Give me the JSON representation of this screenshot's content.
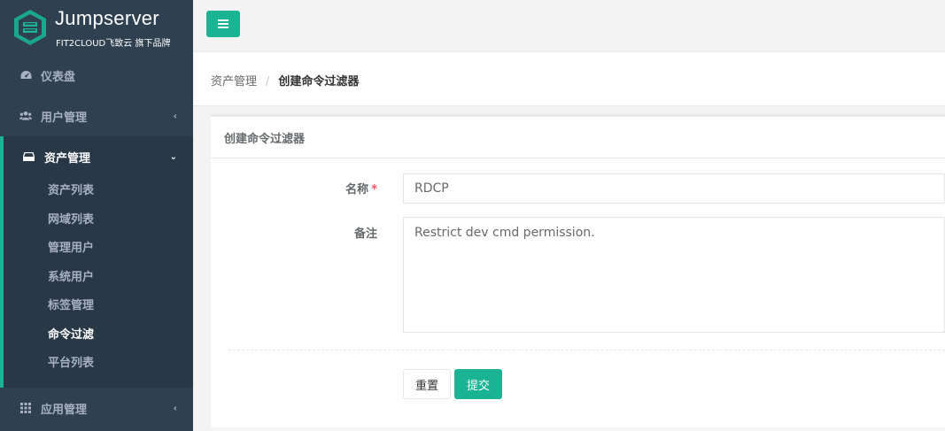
{
  "brand": {
    "title": "Jumpserver",
    "subtitle": "FIT2CLOUD飞致云 旗下品牌"
  },
  "sidebar": {
    "items": [
      {
        "label": "仪表盘",
        "icon": "dashboard-icon"
      },
      {
        "label": "用户管理",
        "icon": "users-icon"
      },
      {
        "label": "资产管理",
        "icon": "inbox-icon",
        "children": [
          "资产列表",
          "网域列表",
          "管理用户",
          "系统用户",
          "标签管理",
          "命令过滤",
          "平台列表"
        ]
      },
      {
        "label": "应用管理",
        "icon": "grid-icon"
      }
    ]
  },
  "breadcrumb": {
    "parent": "资产管理",
    "current": "创建命令过滤器"
  },
  "panel": {
    "title": "创建命令过滤器"
  },
  "form": {
    "name_label": "名称",
    "name_required": "*",
    "name_value": "RDCP",
    "comment_label": "备注",
    "comment_value": "Restrict dev cmd permission.",
    "reset_label": "重置",
    "submit_label": "提交"
  },
  "colors": {
    "sidebar": "#2f4050",
    "accent": "#1ab394",
    "required": "#ed5565"
  }
}
